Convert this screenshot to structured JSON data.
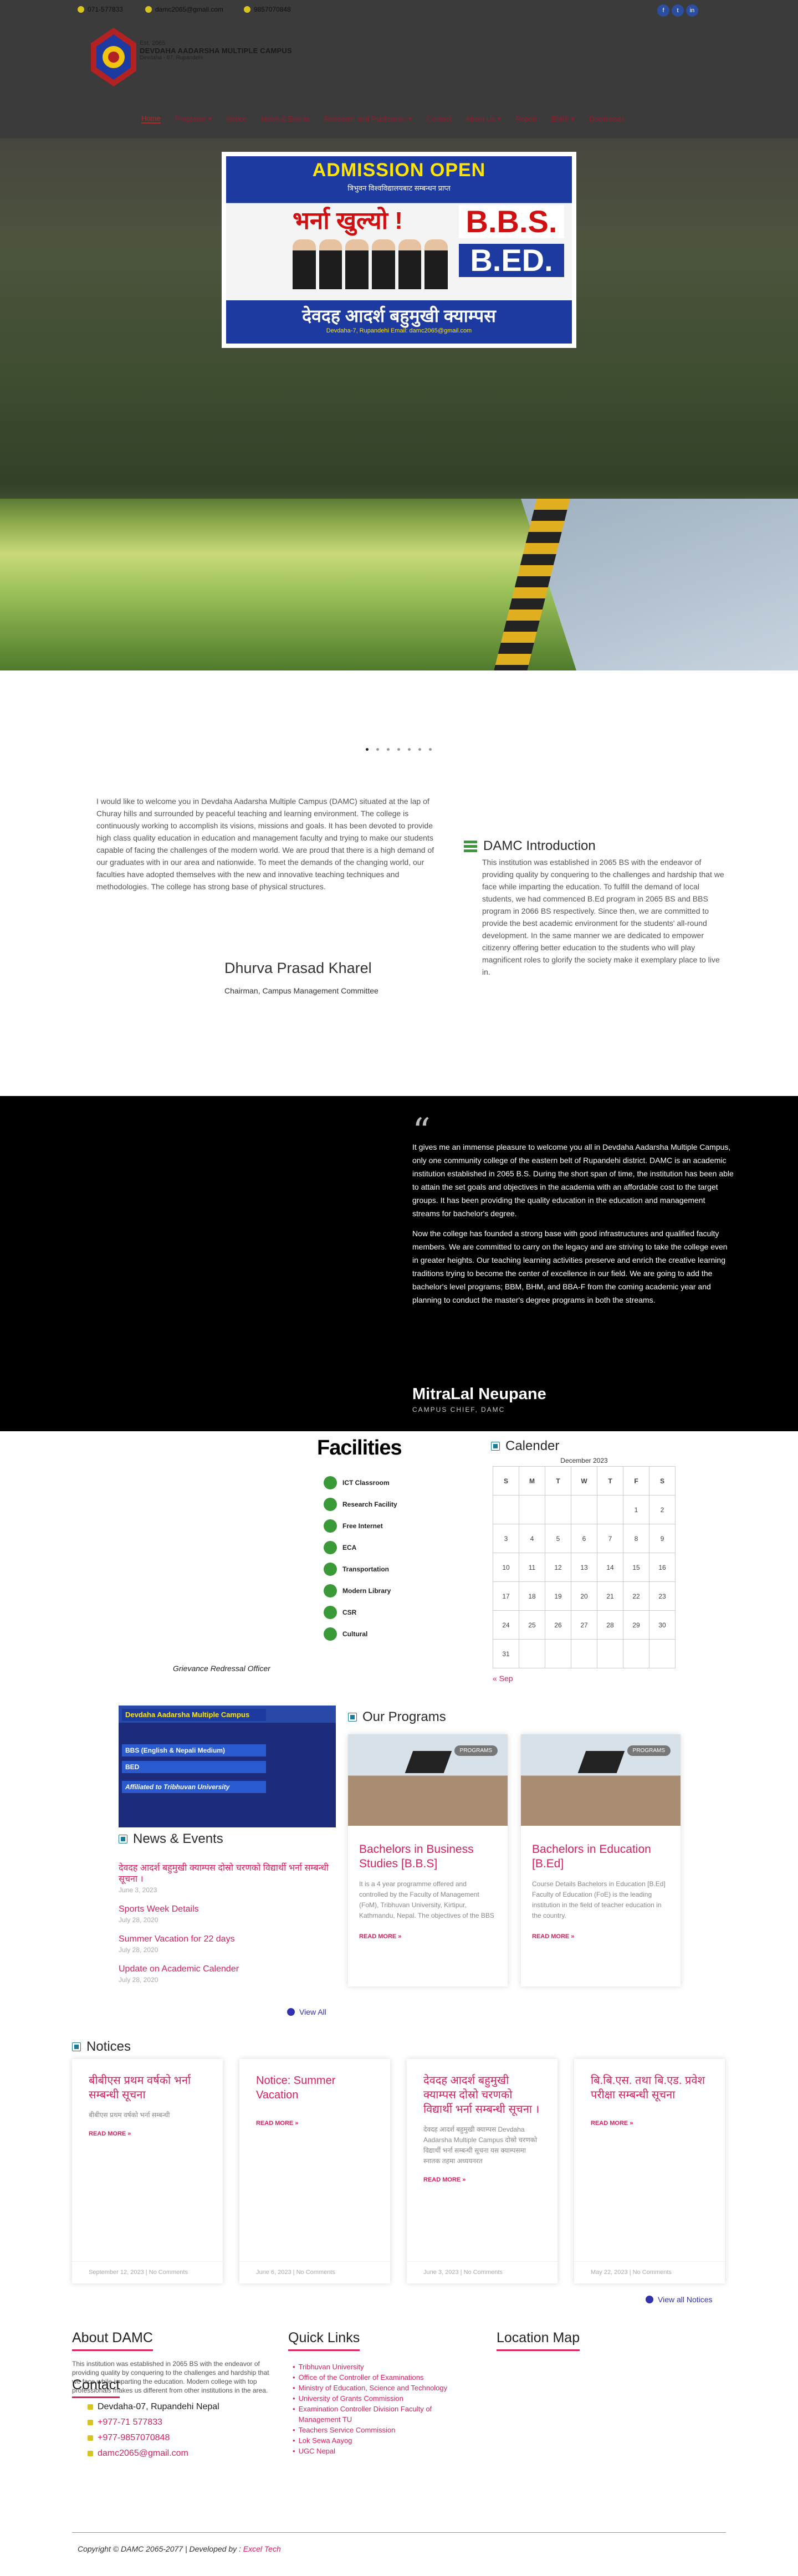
{
  "topbar": {
    "phone1": "071-577833",
    "email": "damc2065@gmail.com",
    "phone2": "9857070848",
    "social": [
      "f",
      "t",
      "in"
    ]
  },
  "brand": {
    "line1": "Est. 2065",
    "line2": "DEVDAHA AADARSHA MULTIPLE CAMPUS",
    "line3": "Devdaha - 07, Rupandehi"
  },
  "nav": [
    "Home",
    "Programs ▾",
    "Notice",
    "News & Events",
    "Research and Publication ▾",
    "Contact",
    "About Us ▾",
    "Report",
    "EMIS ▾",
    "Downloads"
  ],
  "poster": {
    "headline": "ADMISSION OPEN",
    "sub": "त्रिभुवन विश्वविद्यालयबाट सम्बन्धन प्राप्त",
    "bharna": "भर्ना खुल्यो !",
    "bbs": "B.B.S.",
    "bed": "B.ED.",
    "campus": "देवदह आदर्श बहुमुखी क्याम्पस",
    "address": "Devdaha-7, Rupandehi  Email: damc2065@gmail.com"
  },
  "welcome": {
    "text": "I would like to welcome you in Devdaha Aadarsha Multiple Campus (DAMC) situated at the lap of Churay hills and surrounded by peaceful teaching and learning environment. The college is continuously working to accomplish its visions, missions and goals. It has been devoted to provide high class quality education in education and management faculty and trying to make our students capable of facing the challenges of the modern world. We are proud that there is a high demand of our graduates with in our area and nationwide. To meet the demands of the changing world, our faculties have adopted themselves with the new and innovative teaching techniques and methodologies. The college has strong base of physical structures.",
    "name": "Dhurva Prasad Kharel",
    "role": "Chairman, Campus Management Committee"
  },
  "intro": {
    "title": "DAMC Introduction",
    "text": "This institution was established in 2065 BS with the endeavor of providing quality by conquering to the challenges and hardship that we face while imparting the education. To fulfill the demand of local students, we had commenced B.Ed program in 2065 BS and BBS program in 2066 BS respectively. Since then, we are committed to provide the best academic environment for the students' all-round development. In the same manner we are dedicated to empower citizenry offering better education to the students who will play magnificent roles to glorify the society make it exemplary place to live in."
  },
  "chief": {
    "p1": "It gives me an immense pleasure to welcome you all in Devdaha Aadarsha Multiple Campus, only one community college of the eastern belt of Rupandehi district. DAMC is an academic institution established in 2065 B.S. During the short span of time, the institution has been able to attain the set goals and objectives in the academia with an affordable cost to the target groups. It has been providing the quality education in the education and management streams for bachelor's degree.",
    "p2": "Now the college has founded a strong base with good infrastructures and qualified faculty members. We are committed to carry on the legacy and are striving to take the college even in greater heights. Our teaching learning activities preserve and enrich the creative learning traditions trying to become the center of excellence in our field. We are going to add the bachelor's level programs; BBM, BHM, and BBA-F from the coming academic year and planning to conduct the master's degree programs in both the streams.",
    "name": "MitraLal Neupane",
    "role": "CAMPUS CHIEF, DAMC"
  },
  "facilities": {
    "title": "Facilities",
    "items": [
      "ICT Classroom",
      "Research Facility",
      "Free Internet",
      "ECA",
      "Transportation",
      "Modern Library",
      "CSR",
      "Cultural"
    ],
    "grievance": "Grievance Redressal Officer"
  },
  "calendar": {
    "title": "Calender",
    "month": "December 2023",
    "days": [
      "S",
      "M",
      "T",
      "W",
      "T",
      "F",
      "S"
    ],
    "rows": [
      [
        "",
        "",
        "",
        "",
        "",
        "1",
        "2"
      ],
      [
        "3",
        "4",
        "5",
        "6",
        "7",
        "8",
        "9"
      ],
      [
        "10",
        "11",
        "12",
        "13",
        "14",
        "15",
        "16"
      ],
      [
        "17",
        "18",
        "19",
        "20",
        "21",
        "22",
        "23"
      ],
      [
        "24",
        "25",
        "26",
        "27",
        "28",
        "29",
        "30"
      ],
      [
        "31",
        "",
        "",
        "",
        "",
        "",
        ""
      ]
    ],
    "prev": "« Sep"
  },
  "promo": {
    "title": "Devdaha Aadarsha Multiple Campus",
    "bbs": "BBS (English & Nepali Medium)",
    "bed": "BED",
    "aff": "Affiliated to Tribhuvan University"
  },
  "news": {
    "title": "News & Events",
    "items": [
      {
        "t": "देवदह आदर्श बहुमुखी क्याम्पस दोस्रो चरणको विद्यार्थी भर्ना सम्बन्धी सूचना ।",
        "d": "June 3, 2023"
      },
      {
        "t": "Sports Week Details",
        "d": "July 28, 2020"
      },
      {
        "t": "Summer Vacation for 22 days",
        "d": "July 28, 2020"
      },
      {
        "t": "Update on Academic Calender",
        "d": "July 28, 2020"
      }
    ],
    "viewall": "View All"
  },
  "programs": {
    "title": "Our Programs",
    "cards": [
      {
        "badge": "PROGRAMS",
        "title": "Bachelors in Business Studies [B.B.S]",
        "desc": "It is a 4 year programme offered and controlled by the Faculty of Management (FoM), Tribhuvan University, Kirtipur, Kathmandu, Nepal. The objectives of the BBS",
        "more": "READ MORE »"
      },
      {
        "badge": "PROGRAMS",
        "title": "Bachelors in Education [B.Ed]",
        "desc": "Course Details Bachelors in Education [B.Ed] Faculty of Education (FoE) is the leading institution in the field of teacher education in the country.",
        "more": "READ MORE »"
      }
    ]
  },
  "notices": {
    "title": "Notices",
    "cards": [
      {
        "title": "बीबीएस प्रथम वर्षको भर्ना सम्बन्धी सूचना",
        "desc": "बीबीएस प्रथम वर्षको भर्ना सम्बन्धी",
        "more": "READ MORE »",
        "meta": "September 12, 2023  |  No Comments"
      },
      {
        "title": "Notice: Summer Vacation",
        "desc": "",
        "more": "READ MORE »",
        "meta": "June 6, 2023  |  No Comments"
      },
      {
        "title": "देवदह आदर्श बहुमुखी क्याम्पस दोस्रो चरणको विद्यार्थी भर्ना सम्बन्धी सूचना ।",
        "desc": "देवदह आदर्श बहुमुखी क्याम्पस Devdaha Aadarsha Multiple Campus दोस्रो चरणको विद्यार्थी भर्ना सम्बन्धी सूचना यस क्याम्पसमा स्नातक तहमा अध्ययनरत",
        "more": "READ MORE »",
        "meta": "June 3, 2023  |  No Comments"
      },
      {
        "title": "बि.बि.एस. तथा बि.एड. प्रवेश परीक्षा सम्बन्धी सूचना",
        "desc": "",
        "more": "READ MORE »",
        "meta": "May 22, 2023  |  No Comments"
      }
    ],
    "viewall": "View all Notices"
  },
  "footer": {
    "about_title": "About DAMC",
    "about": "This institution was established in 2065 BS with the endeavor of providing quality by conquering to the challenges and hardship that we face while imparting the education. Modern college with top professionals makes us different from other institutions in the area.",
    "contact_title": "Contact",
    "address": "Devdaha-07, Rupandehi Nepal",
    "phone1": "+977-71 577833",
    "phone2": "+977-9857070848",
    "email": "damc2065@gmail.com",
    "ql_title": "Quick Links",
    "links": [
      "Tribhuvan University",
      "Office of the Controller of Examinations",
      "Ministry of Education, Science and Technology",
      "University of Grants Commission",
      "Examination Controller Division Faculty of Management TU",
      "Teachers Service Commission",
      "Lok Sewa Aayog",
      "UGC Nepal"
    ],
    "map_title": "Location Map",
    "copy": "Copyright © DAMC 2065-2077 | Developed by :",
    "dev": "Excel Tech"
  },
  "colors": {
    "accent": "#d81f5f",
    "nav": "#8b1f2e",
    "link": "#3232b0"
  }
}
